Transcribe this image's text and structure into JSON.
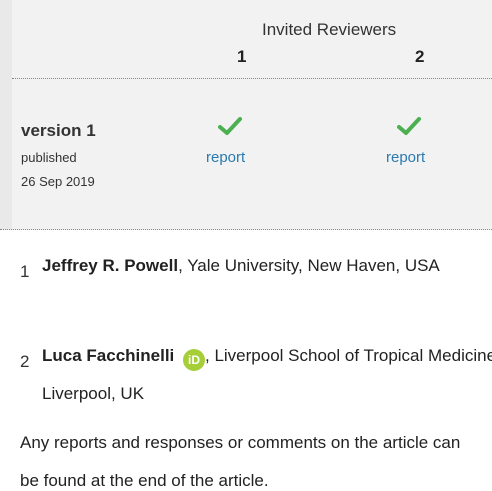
{
  "reviewers_panel": {
    "heading": "Invited Reviewers",
    "columns": [
      "1",
      "2"
    ],
    "version": {
      "label": "version 1",
      "status": "published",
      "date": "26 Sep 2019"
    },
    "reports": [
      {
        "status_icon": "check-icon",
        "link": "report"
      },
      {
        "status_icon": "check-icon",
        "link": "report"
      }
    ],
    "check_color": "#4caf50",
    "link_color": "#2a7ab0"
  },
  "reviewer_list": [
    {
      "number": "1",
      "name": "Jeffrey R. Powell",
      "affiliation": ", Yale University, New Haven, USA"
    },
    {
      "number": "2",
      "name": "Luca Facchinelli",
      "orcid_icon": "orcid-icon",
      "orcid_text": "iD",
      "affiliation": ", Liverpool School of Tropical Medicine, Liverpool, UK"
    }
  ],
  "footer_note": "Any reports and responses or comments on the article can be found at the end of the article."
}
